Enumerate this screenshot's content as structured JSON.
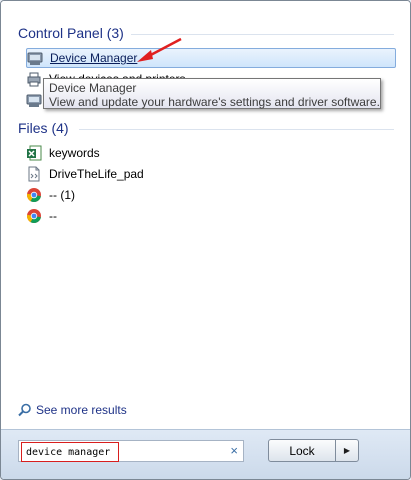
{
  "control_panel": {
    "header": "Control Panel (3)",
    "items": [
      {
        "label": "Device Manager",
        "icon": "device-manager-icon"
      },
      {
        "label": "View devices and printers",
        "icon": "printer-icon"
      },
      {
        "label": "",
        "icon": "device-manager-icon"
      }
    ]
  },
  "tooltip": {
    "title": "Device Manager",
    "description": "View and update your hardware's settings and driver software."
  },
  "files": {
    "header": "Files (4)",
    "items": [
      {
        "label": "keywords",
        "icon": "excel-file-icon"
      },
      {
        "label": "DriveTheLife_pad",
        "icon": "document-file-icon"
      },
      {
        "label": "-- (1)",
        "icon": "chrome-icon"
      },
      {
        "label": "--",
        "icon": "chrome-icon"
      }
    ]
  },
  "see_more": {
    "label": "See more results"
  },
  "search": {
    "value": "device manager",
    "clear": "×"
  },
  "power": {
    "label": "Lock",
    "arrow": "▶"
  },
  "colors": {
    "section_header": "#1e3287",
    "highlight_border": "#d81e1e",
    "selected_border": "#84acdd"
  }
}
